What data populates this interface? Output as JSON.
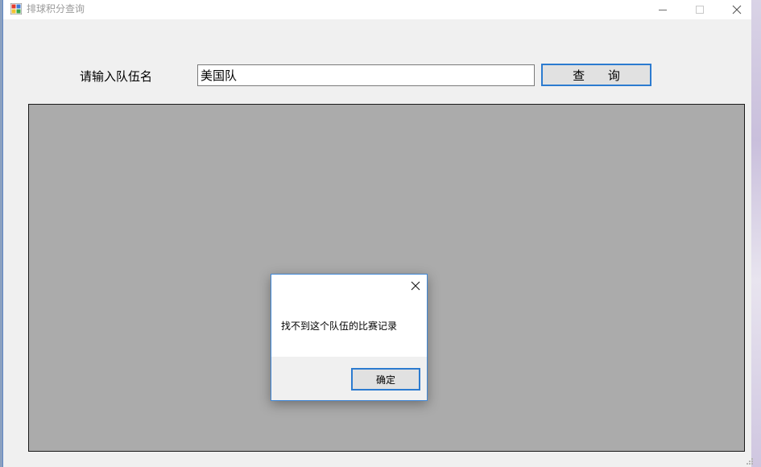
{
  "window": {
    "title": "排球积分查询"
  },
  "form": {
    "team_label": "请输入队伍名",
    "team_input_value": "美国队",
    "query_button_label": "查  询"
  },
  "dialog": {
    "message": "找不到这个队伍的比赛记录",
    "ok_label": "确定"
  },
  "colors": {
    "accent_border": "#2c7bd0",
    "results_background": "#ababab",
    "window_background": "#f0f0f0"
  }
}
